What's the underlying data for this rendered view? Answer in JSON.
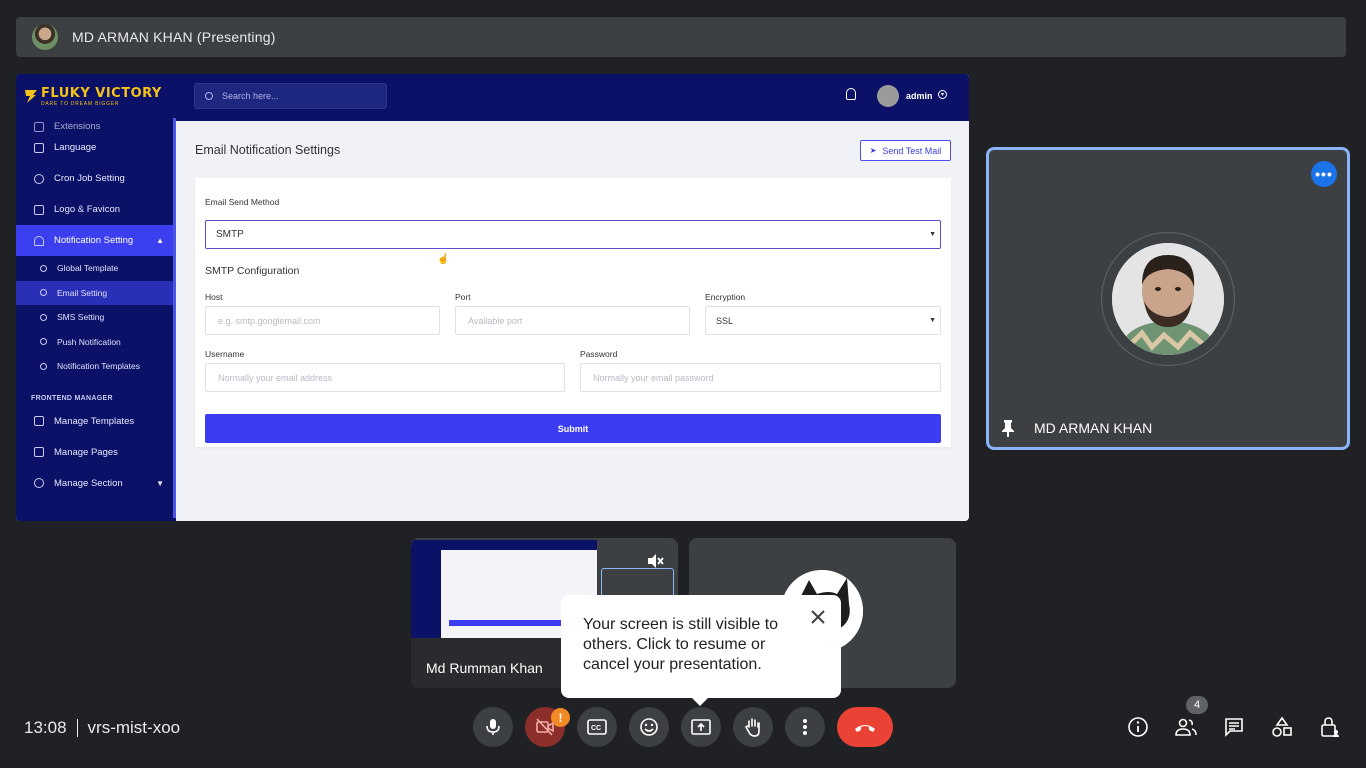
{
  "presenter": {
    "title": "MD ARMAN KHAN (Presenting)"
  },
  "shared_screen": {
    "logo": {
      "brand": "FLUKY VICTORY",
      "tagline": "DARE TO DREAM BIGGER"
    },
    "search_placeholder": "Search here...",
    "user": "admin",
    "sidebar": {
      "cut_item": "Extensions",
      "items": [
        {
          "label": "Language",
          "icon": "language-icon"
        },
        {
          "label": "Cron Job Setting",
          "icon": "clock-icon"
        },
        {
          "label": "Logo & Favicon",
          "icon": "image-icon"
        },
        {
          "label": "Notification Setting",
          "icon": "bell-icon",
          "active": true
        }
      ],
      "sub_items": [
        {
          "label": "Global Template"
        },
        {
          "label": "Email Setting",
          "active": true
        },
        {
          "label": "SMS Setting"
        },
        {
          "label": "Push Notification"
        },
        {
          "label": "Notification Templates"
        }
      ],
      "section": "FRONTEND MANAGER",
      "frontend_items": [
        {
          "label": "Manage Templates",
          "icon": "template-icon"
        },
        {
          "label": "Manage Pages",
          "icon": "list-icon"
        },
        {
          "label": "Manage Section",
          "icon": "puzzle-icon"
        }
      ]
    },
    "page_title": "Email Notification Settings",
    "send_test_label": "Send Test Mail",
    "form": {
      "method_label": "Email Send Method",
      "method_value": "SMTP",
      "smtp_heading": "SMTP Configuration",
      "host_label": "Host",
      "host_placeholder": "e.g. smtp.googlemail.com",
      "port_label": "Port",
      "port_placeholder": "Available port",
      "encryption_label": "Encryption",
      "encryption_value": "SSL",
      "username_label": "Username",
      "username_placeholder": "Normally your email address",
      "password_label": "Password",
      "password_placeholder": "Normally your email password",
      "submit_label": "Submit"
    }
  },
  "pinned_participant": {
    "name": "MD ARMAN KHAN"
  },
  "tiles": [
    {
      "name": "Md Rumman Khan"
    },
    {
      "name": ""
    }
  ],
  "tooltip": {
    "text": "Your screen is still visible to others. Click to resume or cancel your presentation."
  },
  "meeting": {
    "time": "13:08",
    "code": "vrs-mist-xoo",
    "participant_count": "4",
    "camera_alert": "!"
  },
  "colors": {
    "meet_bg": "#202124",
    "end_call": "#ea4335",
    "pin_border": "#8ab4f8",
    "app_navy": "#0a1166",
    "app_primary": "#3c3cf3"
  }
}
